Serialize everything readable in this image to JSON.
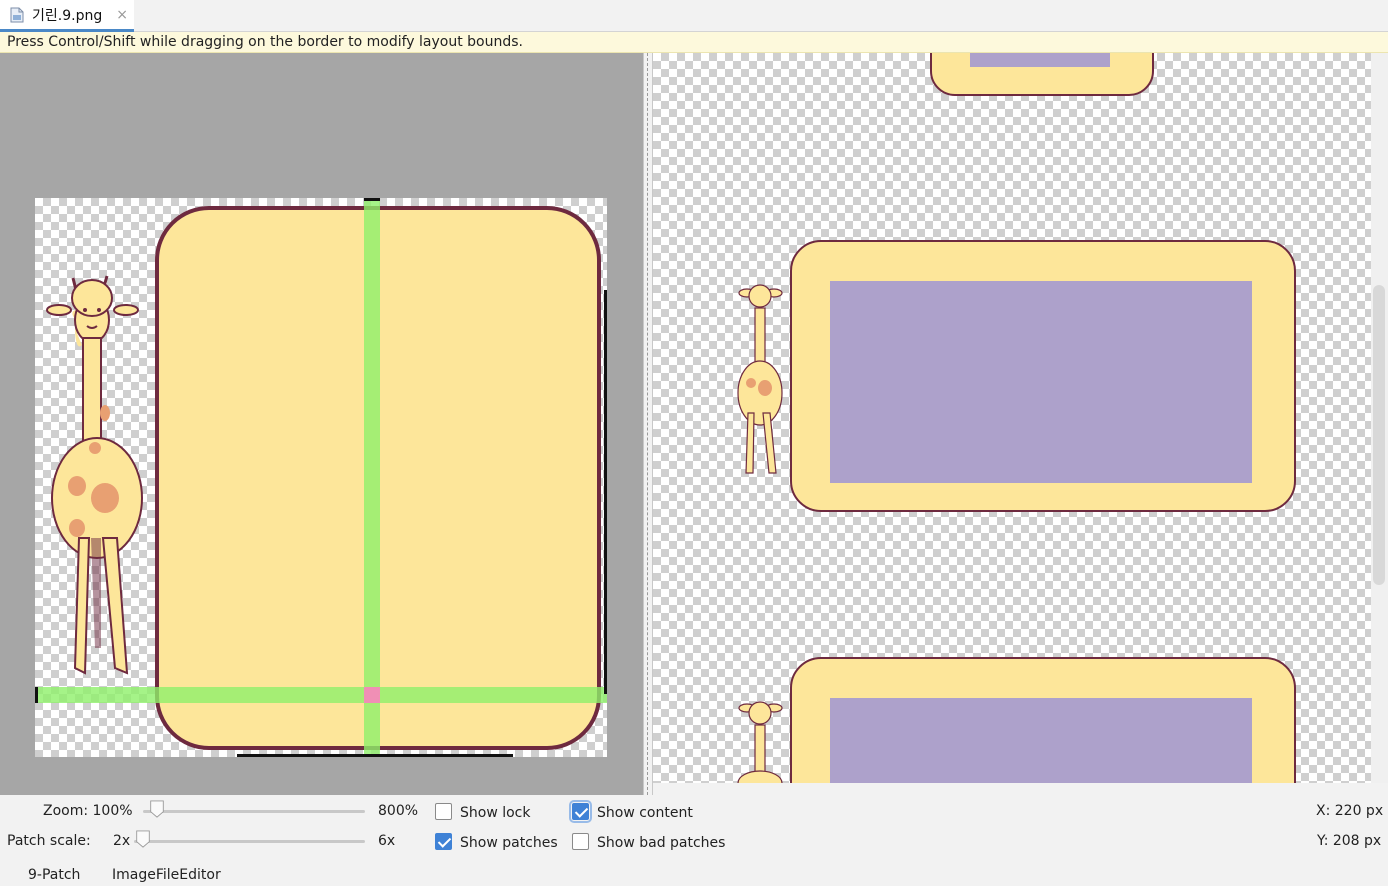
{
  "tab": {
    "title": "기린.9.png",
    "close_glyph": "×",
    "icon": "file-icon"
  },
  "hint": "Press Control/Shift while dragging on the border to modify layout bounds.",
  "zoom": {
    "label": "Zoom: 100%",
    "max_label": "800%",
    "value_percent": 100,
    "min": 100,
    "max": 800
  },
  "patch_scale": {
    "label": "Patch scale:",
    "value_label": "2x",
    "max_label": "6x",
    "value": 2,
    "min": 2,
    "max": 6
  },
  "options": {
    "show_lock": {
      "label": "Show lock",
      "checked": false
    },
    "show_patches": {
      "label": "Show patches",
      "checked": true
    },
    "show_content": {
      "label": "Show content",
      "checked": true
    },
    "show_bad_patches": {
      "label": "Show bad patches",
      "checked": false
    }
  },
  "coords": {
    "x": "X: 220 px",
    "y": "Y: 208 px"
  },
  "bottom_tabs": [
    "9-Patch",
    "ImageFileEditor"
  ],
  "colors": {
    "panel_fill": "#fde69a",
    "panel_border": "#6e2a3f",
    "patch_green": "#8ef06a",
    "patch_overlap": "#f08fb5",
    "content_purple": "#ada1cb",
    "accent": "#3f82d6"
  }
}
